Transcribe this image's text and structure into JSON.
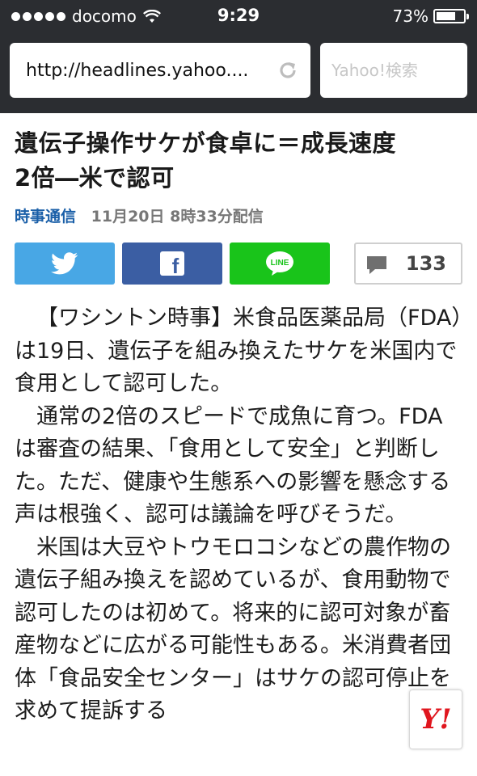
{
  "status_bar": {
    "carrier": "docomo",
    "time": "9:29",
    "battery_percent": "73%",
    "battery_level": 0.73
  },
  "browser": {
    "url": "http://headlines.yahoo....",
    "search_placeholder": "Yahoo!検索"
  },
  "article": {
    "headline_line1": "遺伝子操作サケが食卓に＝成長速度",
    "headline_line2": "2倍―米で認可",
    "source": "時事通信",
    "published": "11月20日 8時33分配信",
    "share": {
      "facebook_glyph": "f",
      "line_label": "LINE",
      "comment_count": "133"
    },
    "paragraphs": [
      "【ワシントン時事】米食品医薬品局（FDA）は19日、遺伝子を組み換えたサケを米国内で食用として認可した。",
      "通常の2倍のスピードで成魚に育つ。FDAは審査の結果、「食用として安全」と判断した。ただ、健康や生態系への影響を懸念する声は根強く、認可は議論を呼びそうだ。",
      "米国は大豆やトウモロコシなどの農作物の遺伝子組み換えを認めているが、食用動物で認可したのは初めて。将来的に認可対象が畜産物などに広がる可能性もある。米消費者団体「食品安全センター」はサケの認可停止を求めて提訴する"
    ]
  },
  "floating_button": {
    "label": "Y!"
  },
  "colors": {
    "chrome": "#2b2d31",
    "twitter": "#48a7e5",
    "facebook": "#3b5ea3",
    "line": "#19c41a",
    "source_link": "#1a5fa8",
    "yahoo_red": "#e0161e"
  }
}
